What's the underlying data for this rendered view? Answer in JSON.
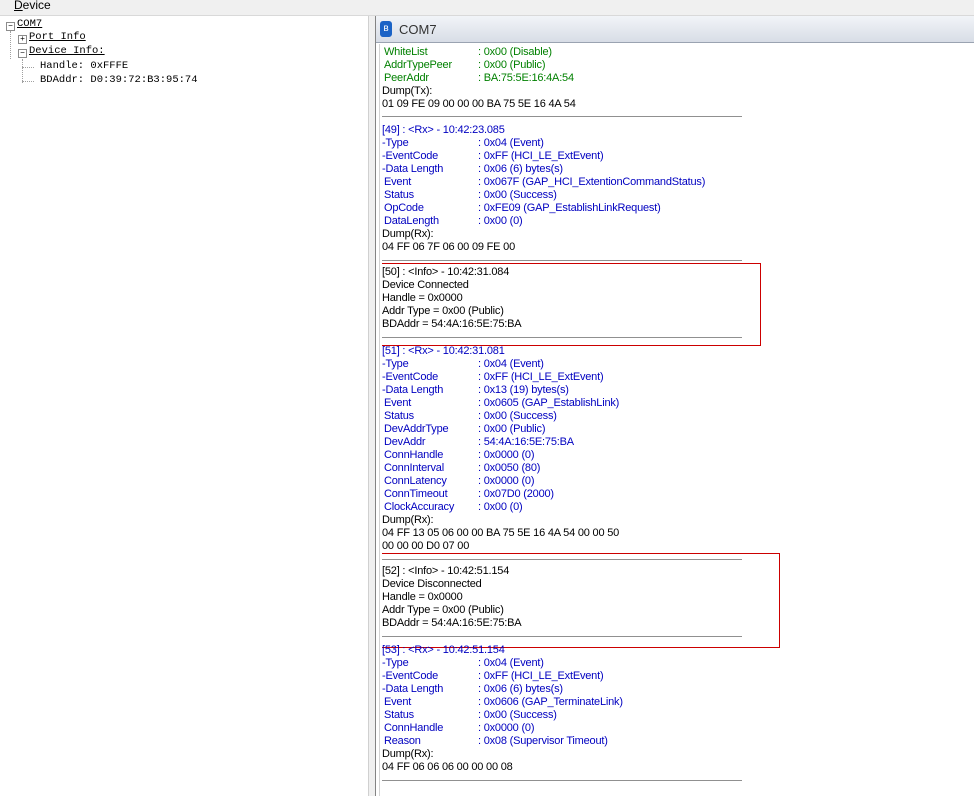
{
  "menubar": {
    "device_mnemonic": "D",
    "device_rest": "evice"
  },
  "tree": {
    "root": "COM7",
    "port_info": "Port Info",
    "device_info": "Device Info:",
    "handle": "Handle: 0xFFFE",
    "bdaddr": "BDAddr: D0:39:72:B3:95:74"
  },
  "tab": {
    "title": "COM7"
  },
  "log": {
    "top": [
      {
        "k": "WhiteList",
        "v": ": 0x00 (Disable)"
      },
      {
        "k": "AddrTypePeer",
        "v": ": 0x00 (Public)"
      },
      {
        "k": "PeerAddr",
        "v": ": BA:75:5E:16:4A:54"
      }
    ],
    "dump_tx_label": "Dump(Tx):",
    "dump_tx": "01 09 FE 09 00 00 00 BA 75 5E 16 4A 54",
    "e49": {
      "header": "[49] : <Rx> - 10:42:23.085",
      "fields": [
        {
          "k": "-Type",
          "v": ": 0x04 (Event)"
        },
        {
          "k": "-EventCode",
          "v": ": 0xFF (HCI_LE_ExtEvent)"
        },
        {
          "k": "-Data Length",
          "v": ": 0x06 (6) bytes(s)"
        },
        {
          "k": " Event",
          "v": ": 0x067F (GAP_HCI_ExtentionCommandStatus)"
        },
        {
          "k": " Status",
          "v": ": 0x00 (Success)"
        },
        {
          "k": " OpCode",
          "v": ": 0xFE09 (GAP_EstablishLinkRequest)"
        },
        {
          "k": " DataLength",
          "v": ": 0x00 (0)"
        }
      ],
      "dump_label": "Dump(Rx):",
      "dump": [
        "04 FF 06 7F 06 00 09 FE 00"
      ]
    },
    "e50": {
      "lines": [
        "[50] : <Info> - 10:42:31.084",
        "Device Connected",
        "Handle = 0x0000",
        "Addr Type = 0x00 (Public)",
        "BDAddr = 54:4A:16:5E:75:BA"
      ]
    },
    "e51": {
      "header": "[51] : <Rx> - 10:42:31.081",
      "fields": [
        {
          "k": "-Type",
          "v": ": 0x04 (Event)"
        },
        {
          "k": "-EventCode",
          "v": ": 0xFF (HCI_LE_ExtEvent)"
        },
        {
          "k": "-Data Length",
          "v": ": 0x13 (19) bytes(s)"
        },
        {
          "k": " Event",
          "v": ": 0x0605 (GAP_EstablishLink)"
        },
        {
          "k": " Status",
          "v": ": 0x00 (Success)"
        },
        {
          "k": " DevAddrType",
          "v": ": 0x00 (Public)"
        },
        {
          "k": " DevAddr",
          "v": ": 54:4A:16:5E:75:BA"
        },
        {
          "k": " ConnHandle",
          "v": ": 0x0000 (0)"
        },
        {
          "k": " ConnInterval",
          "v": ": 0x0050 (80)"
        },
        {
          "k": " ConnLatency",
          "v": ": 0x0000 (0)"
        },
        {
          "k": " ConnTimeout",
          "v": ": 0x07D0 (2000)"
        },
        {
          "k": " ClockAccuracy",
          "v": ": 0x00 (0)"
        }
      ],
      "dump_label": "Dump(Rx):",
      "dump": [
        "04 FF 13 05 06 00 00 BA 75 5E 16 4A 54 00 00 50",
        "00 00 00 D0 07 00"
      ]
    },
    "e52": {
      "lines": [
        "[52] : <Info> - 10:42:51.154",
        "Device Disconnected",
        "Handle = 0x0000",
        "Addr Type = 0x00 (Public)",
        "BDAddr = 54:4A:16:5E:75:BA"
      ]
    },
    "e53": {
      "header": "[53] : <Rx> - 10:42:51.154",
      "fields": [
        {
          "k": "-Type",
          "v": ": 0x04 (Event)"
        },
        {
          "k": "-EventCode",
          "v": ": 0xFF (HCI_LE_ExtEvent)"
        },
        {
          "k": "-Data Length",
          "v": ": 0x06 (6) bytes(s)"
        },
        {
          "k": " Event",
          "v": ": 0x0606 (GAP_TerminateLink)"
        },
        {
          "k": " Status",
          "v": ": 0x00 (Success)"
        },
        {
          "k": " ConnHandle",
          "v": ": 0x0000 (0)"
        },
        {
          "k": " Reason",
          "v": ": 0x08 (Supervisor Timeout)"
        }
      ],
      "dump_label": "Dump(Rx):",
      "dump": [
        "04 FF 06 06 06 00 00 00 08"
      ]
    }
  }
}
